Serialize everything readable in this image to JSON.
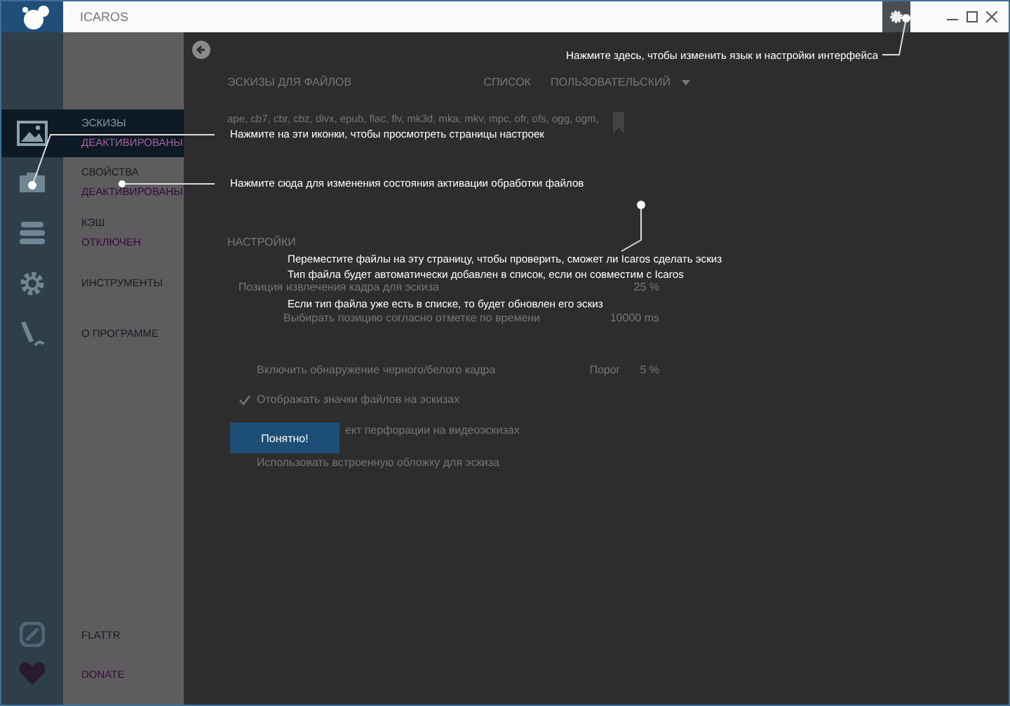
{
  "window": {
    "title": "ICAROS"
  },
  "nav": {
    "items": [
      {
        "label": "ЭСКИЗЫ",
        "status": "ДЕАКТИВИРОВАНЫ",
        "selected": true
      },
      {
        "label": "СВОЙСТВА",
        "status": "ДЕАКТИВИРОВАНЫ",
        "selected": false
      },
      {
        "label": "КЭШ",
        "status": "ОТКЛЮЧЕН",
        "selected": false
      },
      {
        "label": "ИНСТРУМЕНТЫ",
        "selected": false
      },
      {
        "label": "О ПРОГРАММЕ",
        "selected": false
      }
    ],
    "bottom": [
      {
        "label": "FLATTR",
        "kind": "plain"
      },
      {
        "label": "DONATE",
        "kind": "accent"
      }
    ]
  },
  "thumbnails": {
    "title": "ЭСКИЗЫ ДЛЯ ФАЙЛОВ",
    "list_label": "СПИСОК",
    "list_value": "ПОЛЬЗОВАТЕЛЬСКИЙ",
    "extensions": "ape, cb7, cbr, cbz, divx, epub, flac, flv, mk3d, mka, mkv, mpc, ofr, ofs, ogg, ogm,"
  },
  "settings": {
    "title": "НАСТРОЙКИ",
    "rows": [
      {
        "kind": "value",
        "label": "Позиция извлечения кадра для эскиза",
        "value": "25 %"
      },
      {
        "kind": "subvalue",
        "label": "Выбирать позицию согласно отметке по времени",
        "value": "10000 ms"
      },
      {
        "kind": "threshold",
        "label": "Включить обнаружение черного/белого кадра",
        "checked": false,
        "field_label": "Порог",
        "value": "5 %"
      },
      {
        "kind": "check",
        "label": "Отображать значки файлов на эскизах",
        "checked": true
      },
      {
        "kind": "covered",
        "label": "ект перфорации на видеоэскизах"
      },
      {
        "kind": "check",
        "label": "Использовать встроенную обложку для эскиза",
        "checked": false
      }
    ]
  },
  "tour": {
    "callouts": [
      {
        "text": "Нажмите здесь, чтобы изменить язык и настройки интерфейса"
      },
      {
        "text": "Нажмите на эти иконки, чтобы просмотреть страницы настроек"
      },
      {
        "text": "Нажмите сюда для изменения состояния активации обработки файлов"
      },
      {
        "text": "Переместите файлы на эту страницу, чтобы проверить, сможет ли Icaros сделать эскиз"
      },
      {
        "text": "Тип файла будет автоматически добавлен в список, если он совместим с Icaros"
      },
      {
        "text": "Если тип файла уже есть в списке, то будет обновлен его эскиз"
      }
    ],
    "button": "Понятно!"
  }
}
